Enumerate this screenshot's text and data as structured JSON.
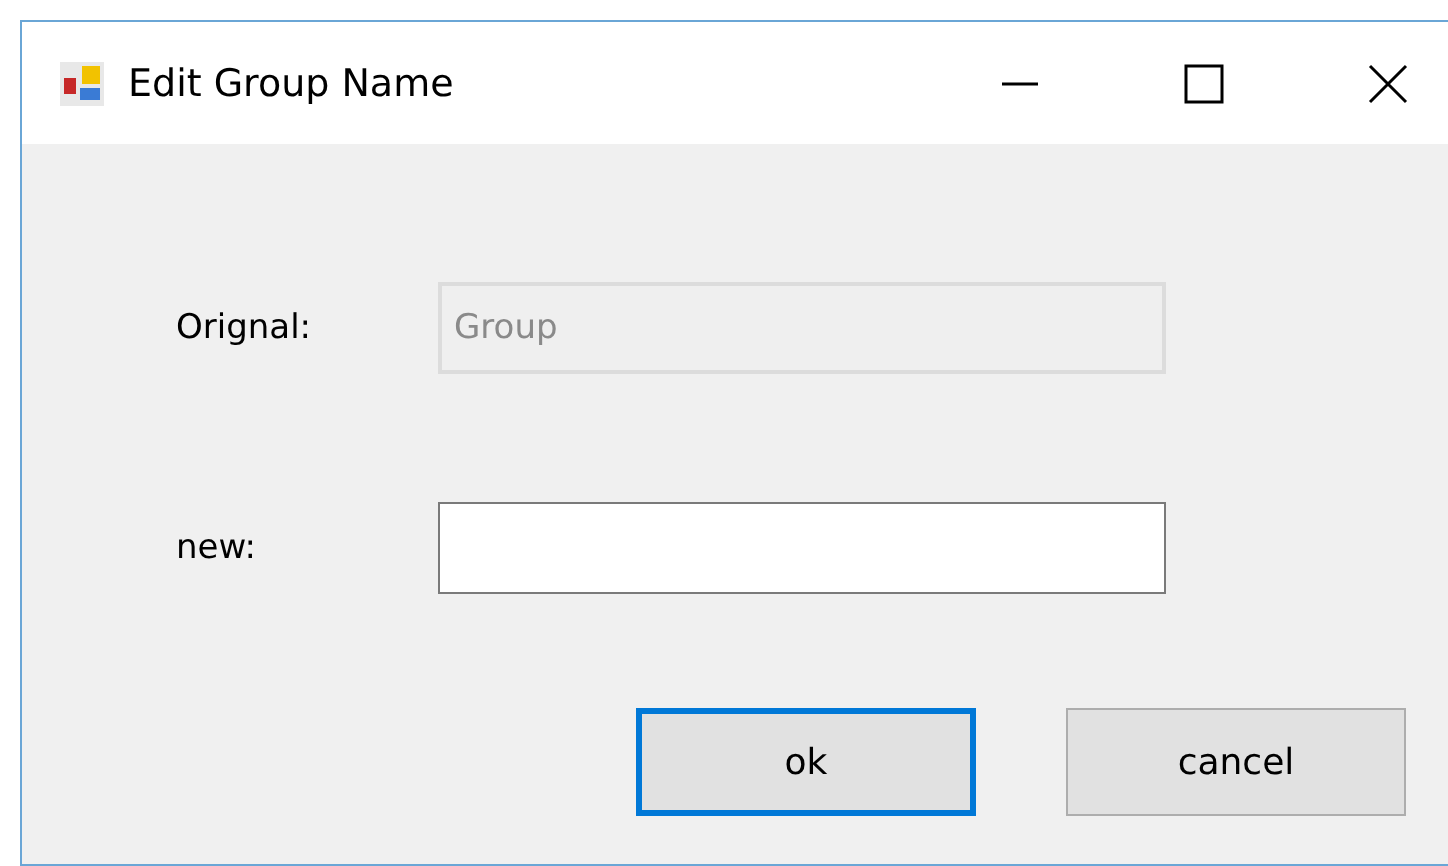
{
  "window": {
    "title": "Edit Group Name"
  },
  "fields": [
    {
      "label": "Orignal:",
      "value": "Group",
      "disabled": true
    },
    {
      "label": "new:",
      "disabled": false
    }
  ],
  "buttons": [
    {
      "label": "ok",
      "focused": true
    },
    {
      "label": "cancel",
      "focused": false
    }
  ]
}
